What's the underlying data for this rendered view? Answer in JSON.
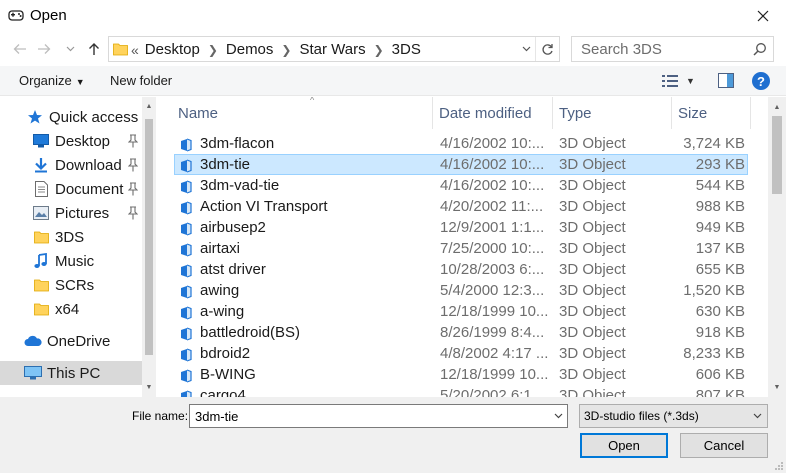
{
  "window": {
    "title": "Open",
    "app_icon": "gamepad-icon",
    "close_icon": "close-icon"
  },
  "navigation": {
    "back_icon": "arrow-left-icon",
    "forward_icon": "arrow-right-icon",
    "recent_icon": "chevron-down-icon",
    "up_icon": "arrow-up-icon"
  },
  "address": {
    "overflow": "«",
    "crumbs": [
      "Desktop",
      "Demos",
      "Star Wars",
      "3DS"
    ]
  },
  "search": {
    "placeholder": "Search 3DS"
  },
  "toolbar": {
    "organize_label": "Organize",
    "new_folder_label": "New folder"
  },
  "nav": {
    "items": [
      {
        "label": "Quick access",
        "icon": "star-icon",
        "pinned": false
      },
      {
        "label": "Desktop",
        "icon": "desktop-icon",
        "pinned": true
      },
      {
        "label": "Download",
        "icon": "download-icon",
        "pinned": true
      },
      {
        "label": "Document",
        "icon": "document-icon",
        "pinned": true
      },
      {
        "label": "Pictures",
        "icon": "pictures-icon",
        "pinned": true
      },
      {
        "label": "3DS",
        "icon": "folder-icon",
        "pinned": false
      },
      {
        "label": "Music",
        "icon": "music-icon",
        "pinned": false
      },
      {
        "label": "SCRs",
        "icon": "folder-icon",
        "pinned": false
      },
      {
        "label": "x64",
        "icon": "folder-icon",
        "pinned": false
      },
      {
        "label": "OneDrive",
        "icon": "cloud-icon",
        "pinned": false
      },
      {
        "label": "This PC",
        "icon": "computer-icon",
        "pinned": false
      }
    ],
    "selected_index": 10
  },
  "columns": {
    "name": "Name",
    "date": "Date modified",
    "type": "Type",
    "size": "Size"
  },
  "files": [
    {
      "name": "3dm-flacon",
      "date": "4/16/2002 10:...",
      "type": "3D Object",
      "size": "3,724 KB"
    },
    {
      "name": "3dm-tie",
      "date": "4/16/2002 10:...",
      "type": "3D Object",
      "size": "293 KB"
    },
    {
      "name": "3dm-vad-tie",
      "date": "4/16/2002 10:...",
      "type": "3D Object",
      "size": "544 KB"
    },
    {
      "name": "Action VI Transport",
      "date": "4/20/2002 11:...",
      "type": "3D Object",
      "size": "988 KB"
    },
    {
      "name": "airbusep2",
      "date": "12/9/2001 1:1...",
      "type": "3D Object",
      "size": "949 KB"
    },
    {
      "name": "airtaxi",
      "date": "7/25/2000 10:...",
      "type": "3D Object",
      "size": "137 KB"
    },
    {
      "name": "atst driver",
      "date": "10/28/2003 6:...",
      "type": "3D Object",
      "size": "655 KB"
    },
    {
      "name": "awing",
      "date": "5/4/2000 12:3...",
      "type": "3D Object",
      "size": "1,520 KB"
    },
    {
      "name": "a-wing",
      "date": "12/18/1999 10...",
      "type": "3D Object",
      "size": "630 KB"
    },
    {
      "name": "battledroid(BS)",
      "date": "8/26/1999 8:4...",
      "type": "3D Object",
      "size": "918 KB"
    },
    {
      "name": "bdroid2",
      "date": "4/8/2002 4:17 ...",
      "type": "3D Object",
      "size": "8,233 KB"
    },
    {
      "name": "B-WING",
      "date": "12/18/1999 10...",
      "type": "3D Object",
      "size": "606 KB"
    },
    {
      "name": "cargo4",
      "date": "5/20/2002 6:1...",
      "type": "3D Object",
      "size": "807 KB"
    }
  ],
  "selected_file_index": 1,
  "footer": {
    "file_name_label": "File name:",
    "file_name_value": "3dm-tie",
    "filter_value": "3D-studio files (*.3ds)",
    "open_label": "Open",
    "cancel_label": "Cancel"
  },
  "colors": {
    "accent": "#0078d7",
    "selection": "#cce8ff",
    "selection_border": "#99d1ff",
    "header_text": "#4d6082",
    "folder": "#ffd35c"
  }
}
